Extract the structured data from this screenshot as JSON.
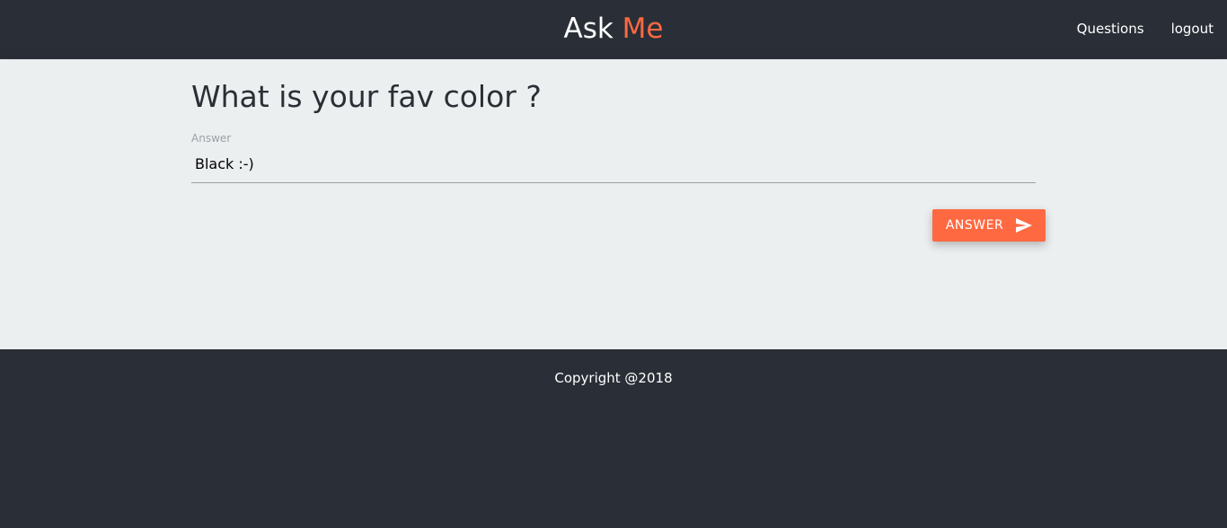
{
  "header": {
    "brand_prefix": "Ask",
    "brand_accent": "Me",
    "nav": {
      "questions": "Questions",
      "logout": "logout"
    }
  },
  "main": {
    "question_title": "What is your fav color ?",
    "answer_field": {
      "label": "Answer",
      "value": "Black :-)"
    },
    "answer_button": {
      "label": "ANSWER",
      "icon": "send-icon"
    }
  },
  "footer": {
    "copyright": "Copyright @2018"
  },
  "colors": {
    "accent": "#ff6942",
    "dark_background": "#2a2f37",
    "content_background": "#eceff0"
  }
}
